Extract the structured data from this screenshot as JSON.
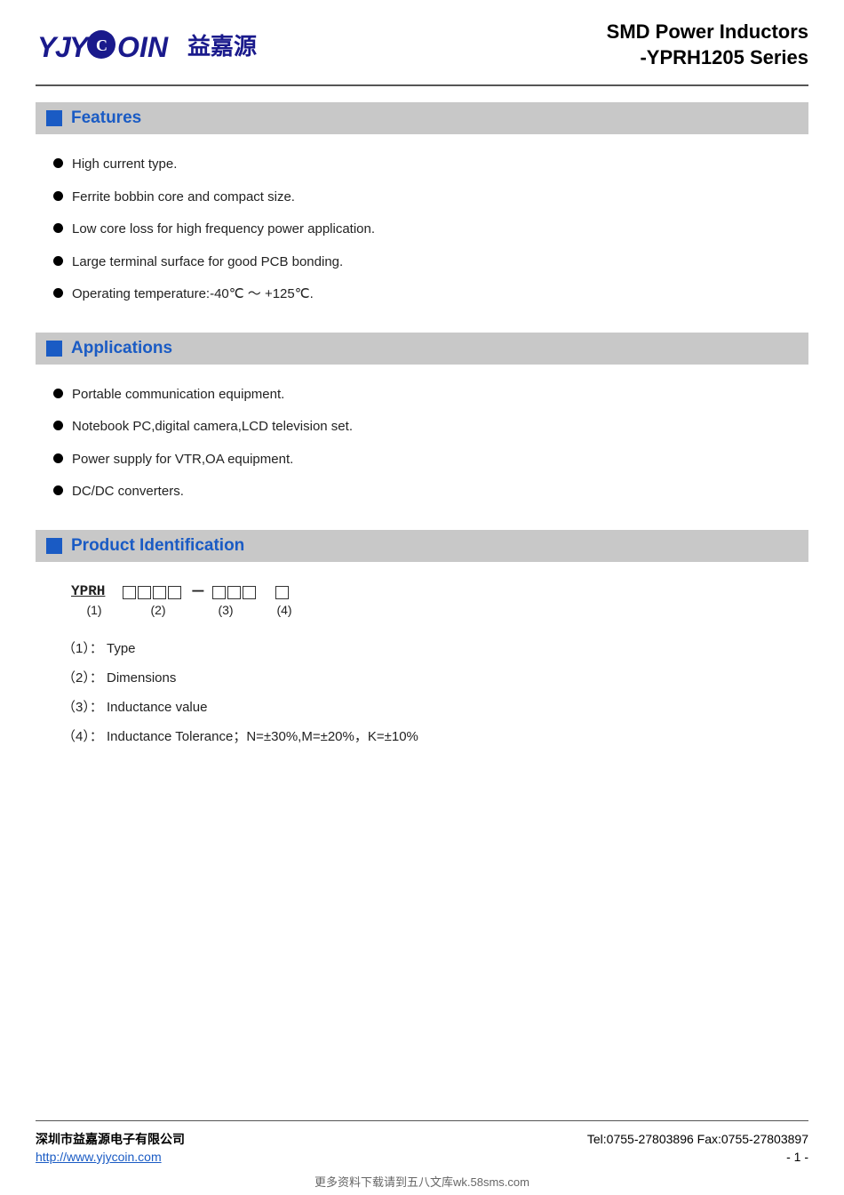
{
  "header": {
    "logo_abbr": "YJYC",
    "logo_circle": "●",
    "logo_in": "IN",
    "logo_cn": "益嘉源",
    "title_line1": "SMD Power Inductors",
    "title_line2": "-YPRH1205 Series"
  },
  "sections": {
    "features": {
      "title": "Features",
      "items": [
        "High current type.",
        "Ferrite bobbin core and compact size.",
        "Low core loss for high frequency power application.",
        "Large terminal surface for good PCB bonding.",
        "Operating temperature:-40℃  ～ +125℃."
      ]
    },
    "applications": {
      "title": "Applications",
      "items": [
        "Portable communication equipment.",
        "Notebook PC,digital camera,LCD television set.",
        "Power supply for VTR,OA equipment.",
        "DC/DC converters."
      ]
    },
    "product_identification": {
      "title": "Product Identification",
      "diagram_label_1": "(1)",
      "diagram_label_2": "(2)",
      "diagram_label_3": "(3)",
      "diagram_label_4": "(4)",
      "detail_1": "（1）：  Type",
      "detail_2": "（2）：  Dimensions",
      "detail_3": "（3）：  Inductance value",
      "detail_4": "（4）：  Inductance Tolerance；N=±30%,M=±20%，K=±10%"
    }
  },
  "footer": {
    "company": "深圳市益嘉源电子有限公司",
    "contact": "Tel:0755-27803896   Fax:0755-27803897",
    "url": "http://www.yjycoin.com",
    "page": "- 1 -",
    "watermark": "更多资料下载请到五八文库wk.58sms.com"
  }
}
